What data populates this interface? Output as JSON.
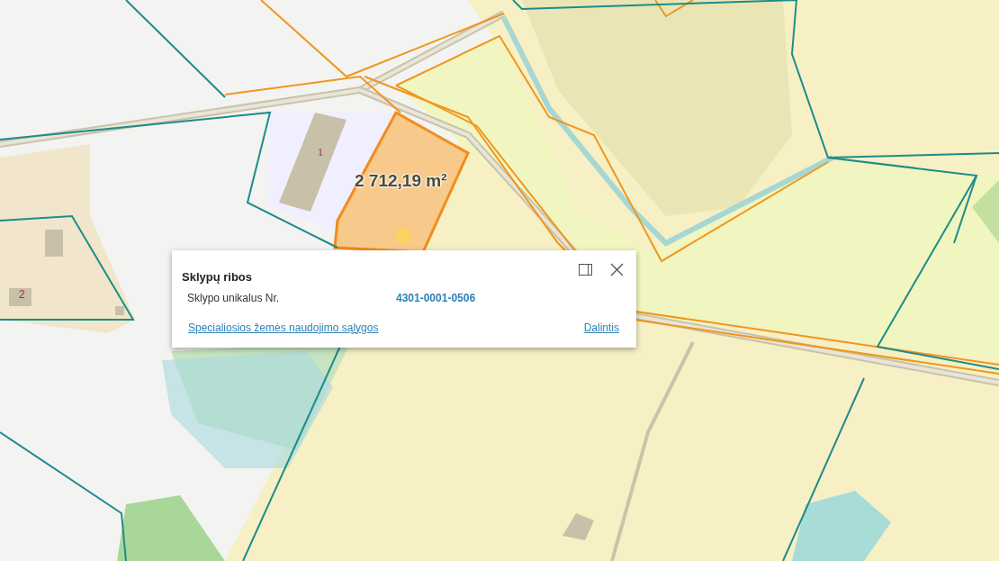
{
  "map": {
    "building_numbers": [
      "1",
      "2"
    ],
    "area_label": "2 712,19 m²"
  },
  "popup": {
    "title": "Sklypų ribos",
    "rows": [
      {
        "label": "Sklypo unikalus Nr.",
        "value": "4301-0001-0506"
      }
    ],
    "links": [
      {
        "text": "Specialiosios žemės naudojimo sąlygos"
      },
      {
        "text": "Dalintis"
      }
    ]
  }
}
